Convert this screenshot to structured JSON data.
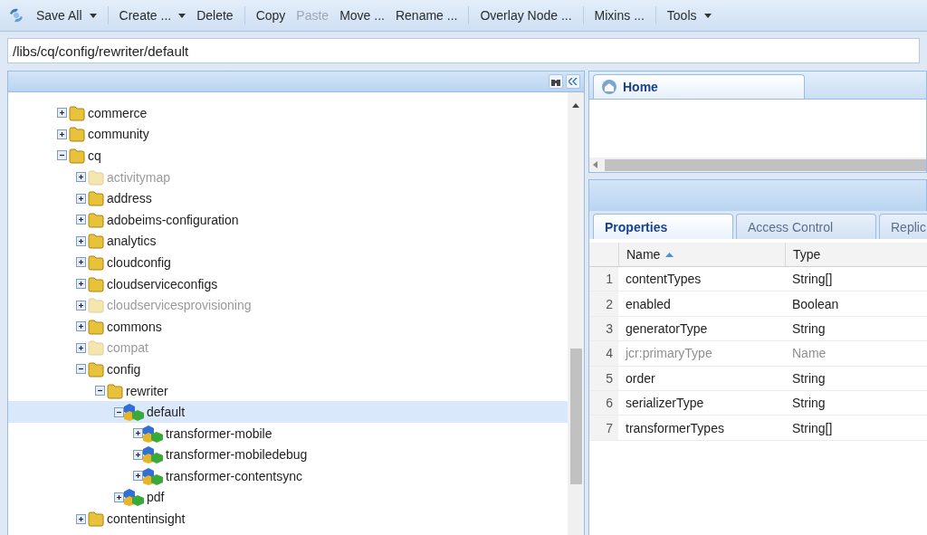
{
  "toolbar": {
    "groups": [
      [
        {
          "label": "Save All",
          "dropdown": true,
          "disabled": false
        }
      ],
      [
        {
          "label": "Create ...",
          "dropdown": true,
          "disabled": false
        },
        {
          "label": "Delete",
          "dropdown": false,
          "disabled": false
        }
      ],
      [
        {
          "label": "Copy",
          "dropdown": false,
          "disabled": false
        },
        {
          "label": "Paste",
          "dropdown": false,
          "disabled": true
        },
        {
          "label": "Move ...",
          "dropdown": false,
          "disabled": false
        },
        {
          "label": "Rename ...",
          "dropdown": false,
          "disabled": false
        }
      ],
      [
        {
          "label": "Overlay Node ...",
          "dropdown": false,
          "disabled": false
        }
      ],
      [
        {
          "label": "Mixins ...",
          "dropdown": false,
          "disabled": false
        }
      ],
      [
        {
          "label": "Tools",
          "dropdown": true,
          "disabled": false
        }
      ]
    ]
  },
  "path": {
    "value": "/libs/cq/config/rewriter/default"
  },
  "tree": {
    "items": [
      {
        "label": "commerce",
        "kind": "folder",
        "expanded": false,
        "selected": false,
        "disabled": false
      },
      {
        "label": "community",
        "kind": "folder",
        "expanded": false,
        "selected": false,
        "disabled": false
      },
      {
        "label": "cq",
        "kind": "folder",
        "expanded": true,
        "selected": false,
        "disabled": false,
        "children": [
          {
            "label": "activitymap",
            "kind": "folder",
            "expanded": false,
            "selected": false,
            "disabled": true
          },
          {
            "label": "address",
            "kind": "folder",
            "expanded": false,
            "selected": false,
            "disabled": false
          },
          {
            "label": "adobeims-configuration",
            "kind": "folder",
            "expanded": false,
            "selected": false,
            "disabled": false
          },
          {
            "label": "analytics",
            "kind": "folder",
            "expanded": false,
            "selected": false,
            "disabled": false
          },
          {
            "label": "cloudconfig",
            "kind": "folder",
            "expanded": false,
            "selected": false,
            "disabled": false
          },
          {
            "label": "cloudserviceconfigs",
            "kind": "folder",
            "expanded": false,
            "selected": false,
            "disabled": false
          },
          {
            "label": "cloudservicesprovisioning",
            "kind": "folder",
            "expanded": false,
            "selected": false,
            "disabled": true
          },
          {
            "label": "commons",
            "kind": "folder",
            "expanded": false,
            "selected": false,
            "disabled": false
          },
          {
            "label": "compat",
            "kind": "folder",
            "expanded": false,
            "selected": false,
            "disabled": true
          },
          {
            "label": "config",
            "kind": "folder",
            "expanded": true,
            "selected": false,
            "disabled": false,
            "children": [
              {
                "label": "rewriter",
                "kind": "folder",
                "expanded": true,
                "selected": false,
                "disabled": false,
                "children": [
                  {
                    "label": "default",
                    "kind": "node",
                    "expanded": true,
                    "selected": true,
                    "disabled": false,
                    "children": [
                      {
                        "label": "transformer-mobile",
                        "kind": "node",
                        "expanded": false,
                        "selected": false,
                        "disabled": false
                      },
                      {
                        "label": "transformer-mobiledebug",
                        "kind": "node",
                        "expanded": false,
                        "selected": false,
                        "disabled": false
                      },
                      {
                        "label": "transformer-contentsync",
                        "kind": "node",
                        "expanded": false,
                        "selected": false,
                        "disabled": false
                      }
                    ]
                  },
                  {
                    "label": "pdf",
                    "kind": "node",
                    "expanded": false,
                    "selected": false,
                    "disabled": false
                  }
                ]
              }
            ]
          },
          {
            "label": "contentinsight",
            "kind": "folder",
            "expanded": false,
            "selected": false,
            "disabled": false
          }
        ]
      }
    ]
  },
  "home_tab": {
    "label": "Home"
  },
  "tabs": [
    {
      "label": "Properties",
      "selected": true
    },
    {
      "label": "Access Control",
      "selected": false
    },
    {
      "label": "Replic",
      "selected": false
    }
  ],
  "table": {
    "columns": [
      {
        "label": "Name",
        "sorted": true
      },
      {
        "label": "Type",
        "sorted": false
      }
    ],
    "rows": [
      {
        "number": "1",
        "name": "contentTypes",
        "type": "String[]",
        "disabled": false
      },
      {
        "number": "2",
        "name": "enabled",
        "type": "Boolean",
        "disabled": false
      },
      {
        "number": "3",
        "name": "generatorType",
        "type": "String",
        "disabled": false
      },
      {
        "number": "4",
        "name": "jcr:primaryType",
        "type": "Name",
        "disabled": true
      },
      {
        "number": "5",
        "name": "order",
        "type": "String",
        "disabled": false
      },
      {
        "number": "6",
        "name": "serializerType",
        "type": "String",
        "disabled": false
      },
      {
        "number": "7",
        "name": "transformerTypes",
        "type": "String[]",
        "disabled": false
      }
    ]
  }
}
